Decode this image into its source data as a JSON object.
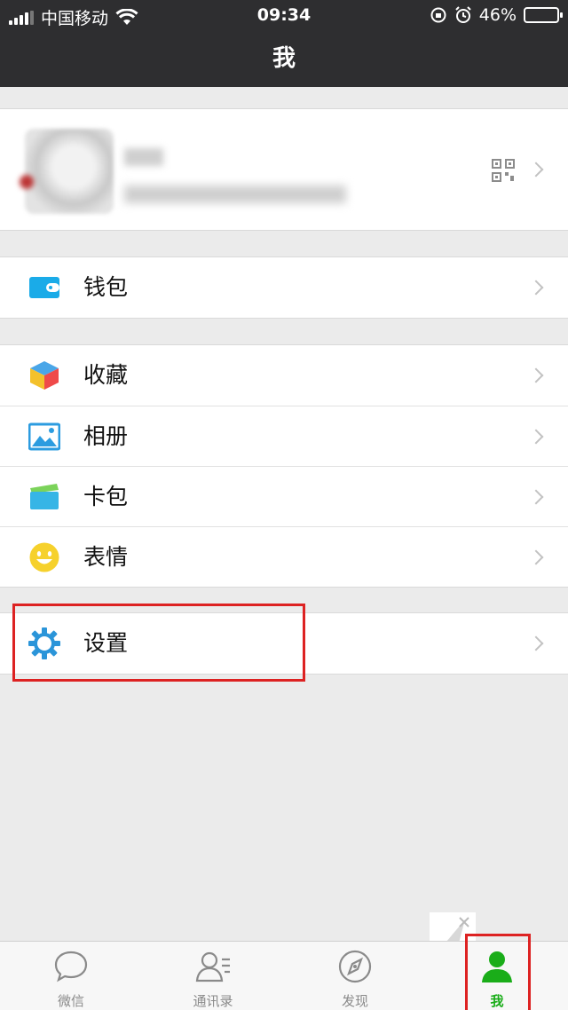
{
  "status_bar": {
    "carrier": "中国移动",
    "time": "09:34",
    "battery_percent": "46%",
    "battery_level": 0.46
  },
  "nav": {
    "title": "我"
  },
  "profile": {
    "avatar": "avatar-blurred"
  },
  "wallet_group": [
    {
      "label": "钱包",
      "icon": "wallet-icon",
      "color": "#1aabe8"
    }
  ],
  "main_group": [
    {
      "label": "收藏",
      "icon": "favorites-cube-icon"
    },
    {
      "label": "相册",
      "icon": "album-icon",
      "color": "#2c9ce0"
    },
    {
      "label": "卡包",
      "icon": "card-wallet-icon",
      "color": "#36b5e6"
    },
    {
      "label": "表情",
      "icon": "sticker-smiley-icon",
      "color": "#f6d12c"
    }
  ],
  "settings_group": [
    {
      "label": "设置",
      "icon": "gear-icon",
      "color": "#2b95d9"
    }
  ],
  "tabbar": [
    {
      "label": "微信",
      "icon": "chat-bubble-icon"
    },
    {
      "label": "通讯录",
      "icon": "contacts-icon"
    },
    {
      "label": "发现",
      "icon": "compass-icon"
    },
    {
      "label": "我",
      "icon": "person-icon",
      "active": true
    }
  ],
  "colors": {
    "header_bg": "#2e2e30",
    "page_bg": "#ebebeb",
    "active_tab": "#1aad19",
    "highlight_box": "#d22222"
  }
}
